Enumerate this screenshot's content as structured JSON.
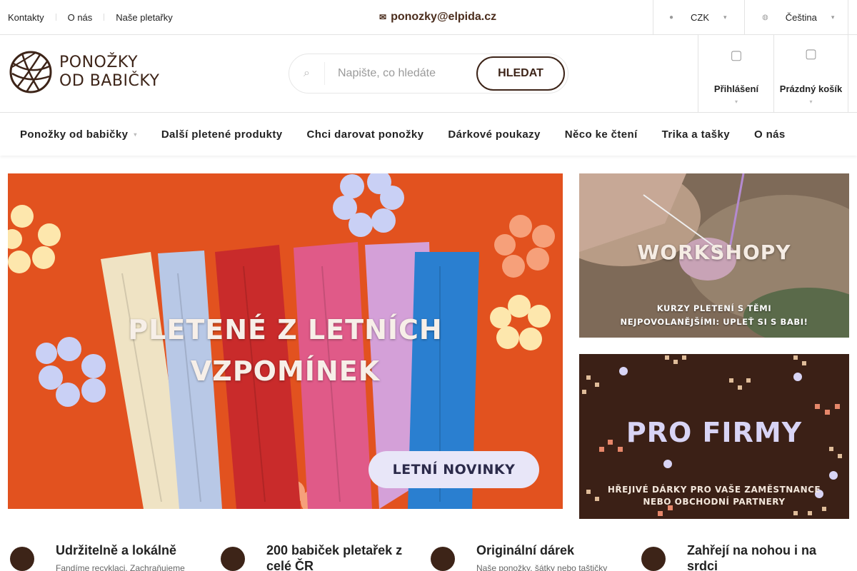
{
  "topbar": {
    "links": [
      "Kontakty",
      "O nás",
      "Naše pletařky"
    ],
    "email_icon": "envelope-icon",
    "email": "ponozky@elpida.cz",
    "currency": {
      "icon": "coin-icon",
      "value": "CZK"
    },
    "language": {
      "icon": "globe-icon",
      "value": "Čeština"
    }
  },
  "header": {
    "logo": {
      "line1": "PONOŽKY",
      "line2": "OD BABIČKY"
    },
    "search": {
      "icon": "search-icon",
      "placeholder": "Napište, co hledáte",
      "button": "HLEDAT"
    },
    "login": {
      "icon": "user-icon",
      "label": "Přihlášení"
    },
    "cart": {
      "icon": "cart-icon",
      "label": "Prázdný košík"
    }
  },
  "nav": {
    "items": [
      "Ponožky od babičky",
      "Další pletené produkty",
      "Chci darovat ponožky",
      "Dárkové poukazy",
      "Něco ke čtení",
      "Trika a tašky",
      "O nás"
    ]
  },
  "banners": {
    "main": {
      "title_line1": "PLETENÉ Z LETNÍCH",
      "title_line2": "VZPOMÍNEK",
      "cta": "LETNÍ NOVINKY"
    },
    "workshops": {
      "title": "WORKSHOPY",
      "sub_line1": "KURZY PLETENÍ S TĚMI",
      "sub_line2": "NEJPOVOLANĚJŠÍMI: UPLEŤ SI S BABI!"
    },
    "companies": {
      "title": "PRO FIRMY",
      "sub_line1": "HŘEJIVÉ DÁRKY PRO VAŠE ZAMĚSTNANCE",
      "sub_line2": "NEBO OBCHODNÍ PARTNERY"
    }
  },
  "features": [
    {
      "title": "Udržitelně a lokálně",
      "text": "Fandíme recyklaci. Zachraňujeme"
    },
    {
      "title": "200 babiček pletařek z celé ČR",
      "text": ""
    },
    {
      "title": "Originální dárek",
      "text": "Naše ponožky, šátky nebo taštičky"
    },
    {
      "title": "Zahřejí na nohou i na srdci",
      "text": ""
    }
  ],
  "colors": {
    "brand_brown": "#3d2418",
    "banner_orange": "#e2521f",
    "banner_dark": "#3b2016"
  }
}
